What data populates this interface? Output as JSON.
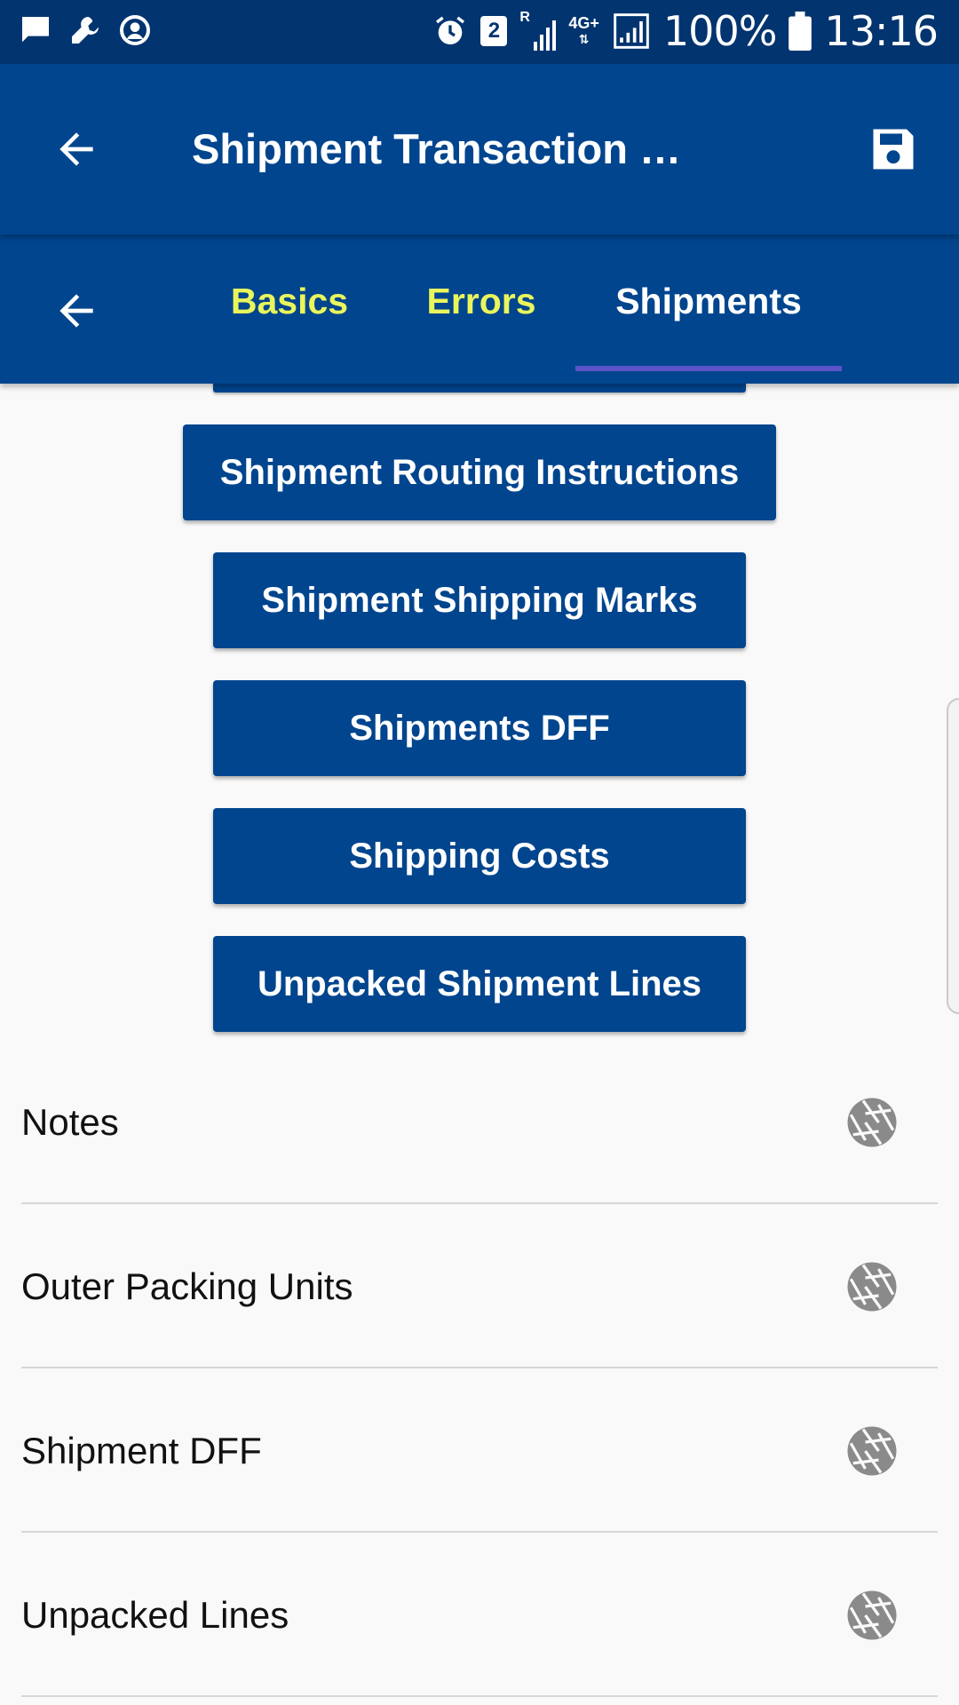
{
  "status_bar": {
    "battery": "100%",
    "time": "13:16",
    "sim_badge": "2",
    "network": "4G+",
    "roaming": "R",
    "icons": [
      "message-icon",
      "wrench-icon",
      "account-circle-icon",
      "alarm-icon",
      "signal-icon",
      "battery-icon"
    ]
  },
  "app_bar": {
    "title": "Shipment Transaction …",
    "back_icon": "arrow-left-icon",
    "save_icon": "floppy-save-icon"
  },
  "tabs": {
    "items": [
      {
        "label": "Basics",
        "active": false
      },
      {
        "label": "Errors",
        "active": false
      },
      {
        "label": "Shipments",
        "active": true
      }
    ],
    "colors": {
      "inactive": "#eaf55c",
      "active": "#ffffff",
      "indicator": "#5b53c8"
    }
  },
  "buttons": [
    {
      "label": "Shipment Routing Instructions"
    },
    {
      "label": "Shipment Shipping Marks"
    },
    {
      "label": "Shipments DFF"
    },
    {
      "label": "Shipping Costs"
    },
    {
      "label": "Unpacked Shipment Lines"
    }
  ],
  "list": [
    {
      "label": "Notes",
      "icon": "aperture-icon"
    },
    {
      "label": "Outer Packing Units",
      "icon": "aperture-icon"
    },
    {
      "label": "Shipment DFF",
      "icon": "aperture-icon"
    },
    {
      "label": "Unpacked Lines",
      "icon": "aperture-icon"
    }
  ],
  "colors": {
    "primary": "#01458e",
    "status_bar": "#02346f",
    "background": "#f9f9f9"
  }
}
